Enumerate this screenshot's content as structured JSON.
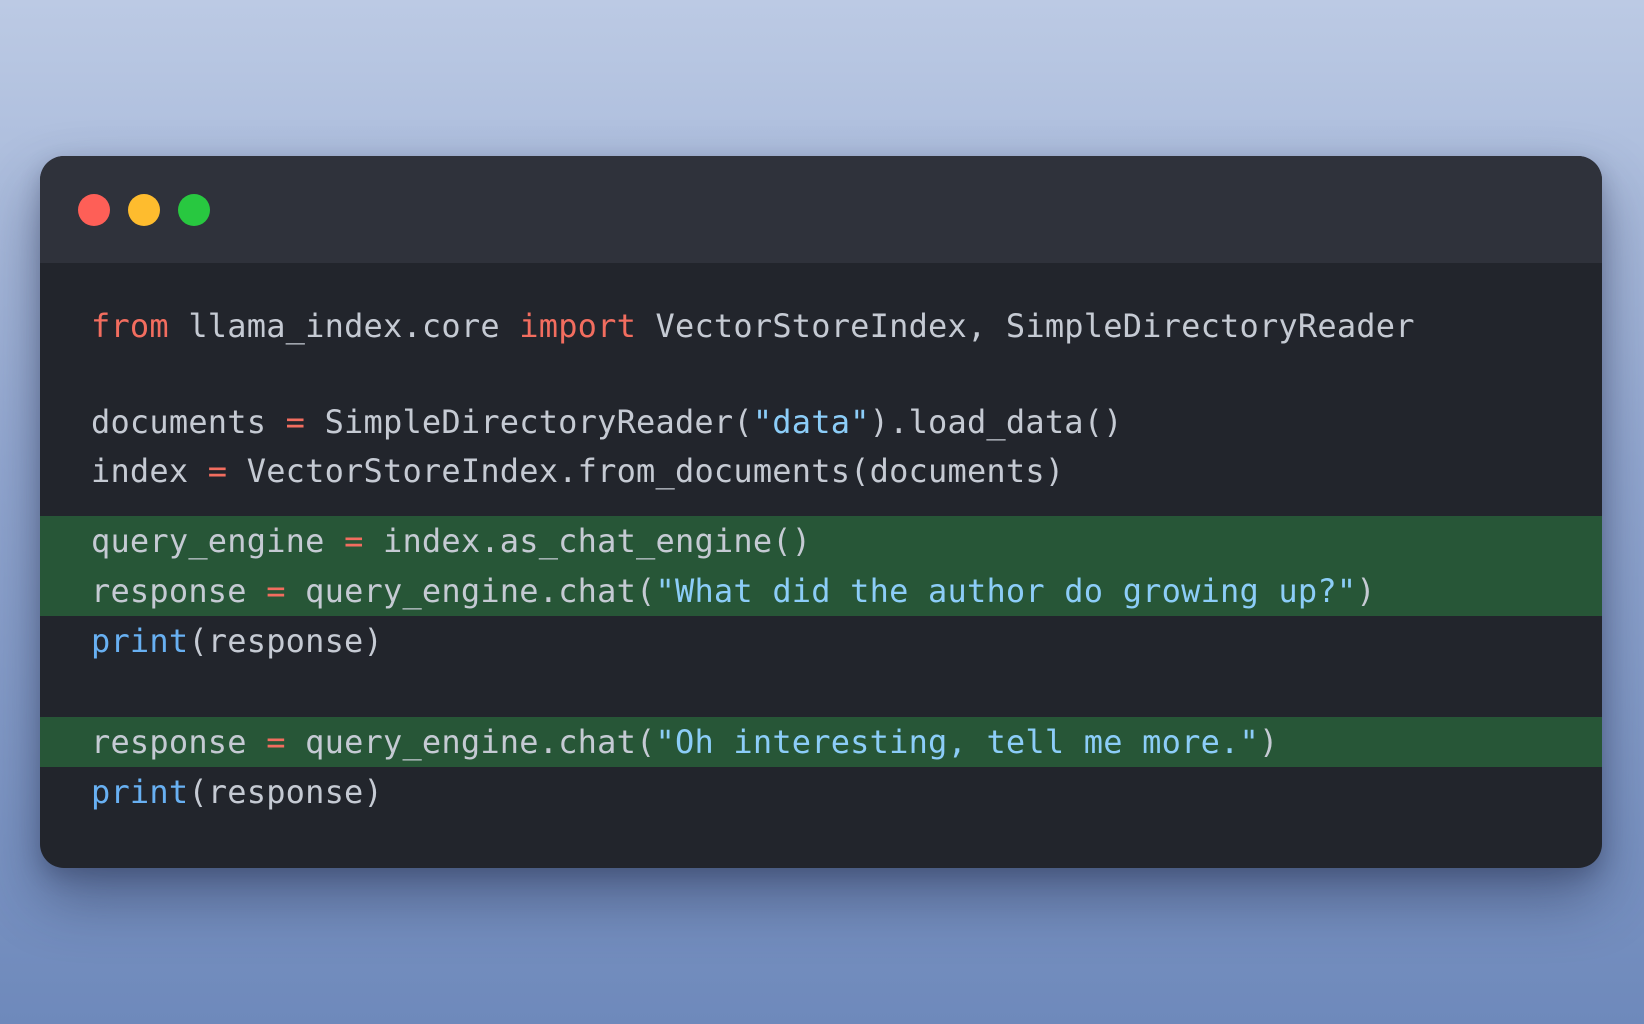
{
  "window": {
    "traffic_lights": [
      {
        "name": "close",
        "color": "#fe5f57"
      },
      {
        "name": "minimize",
        "color": "#febc2e"
      },
      {
        "name": "zoom",
        "color": "#28c840"
      }
    ]
  },
  "colors": {
    "keyword": "#f26d5f",
    "string": "#8ccdf8",
    "builtin": "#68b0f2",
    "text": "#c5cad3",
    "highlight": "#275637",
    "editor_bg": "#22252c",
    "titlebar_bg": "#2f323b"
  },
  "code": {
    "l1": {
      "t1": "from",
      "t2": " llama_index.core ",
      "t3": "import",
      "t4": " VectorStoreIndex, SimpleDirectoryReader"
    },
    "l3": {
      "t1": "documents ",
      "t2": "=",
      "t3": " SimpleDirectoryReader(",
      "t4": "\"data\"",
      "t5": ").load_data()"
    },
    "l4": {
      "t1": "index ",
      "t2": "=",
      "t3": " VectorStoreIndex.from_documents(documents)"
    },
    "l5": {
      "t1": "query_engine ",
      "t2": "=",
      "t3": " index.as_chat_engine()"
    },
    "l6": {
      "t1": "response ",
      "t2": "=",
      "t3": " query_engine.chat(",
      "t4": "\"What did the author do growing up?\"",
      "t5": ")"
    },
    "l7": {
      "t1": "print",
      "t2": "(response)"
    },
    "l9": {
      "t1": "response ",
      "t2": "=",
      "t3": " query_engine.chat(",
      "t4": "\"Oh interesting, tell me more.\"",
      "t5": ")"
    },
    "l10": {
      "t1": "print",
      "t2": "(response)"
    }
  }
}
